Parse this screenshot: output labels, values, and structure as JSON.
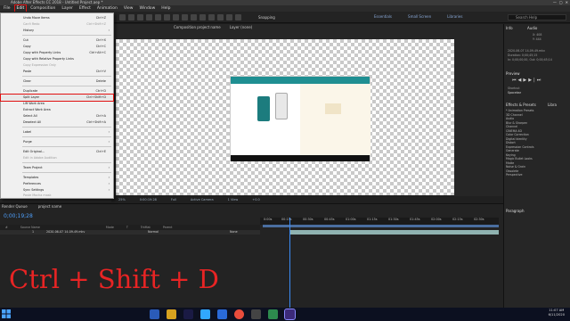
{
  "titlebar": {
    "title": "Adobe After Effects CC 2018 - Untitled Project.aep *"
  },
  "menubar": {
    "items": [
      "File",
      "Edit",
      "Composition",
      "Layer",
      "Effect",
      "Animation",
      "View",
      "Window",
      "Help"
    ],
    "active": "Edit"
  },
  "toolbar": {
    "snapping": "Snapping",
    "workspaces": [
      "Essentials",
      "Small Screen",
      "Libraries"
    ],
    "search_placeholder": "Search Help"
  },
  "comp_panel": {
    "tabs": [
      "Composition project name",
      "Layer (none)"
    ],
    "view_bar": [
      "25%",
      "0:00:19:28",
      "Full",
      "Active Camera",
      "1 View",
      "+0.0"
    ]
  },
  "edit_menu": {
    "items": [
      {
        "label": "Undo Move Items",
        "shortcut": "Ctrl+Z",
        "disabled": false
      },
      {
        "label": "Can't Redo",
        "shortcut": "Ctrl+Shift+Z",
        "disabled": true
      },
      {
        "label": "History",
        "shortcut": "",
        "disabled": false,
        "submenu": true
      },
      {
        "label": "Cut",
        "shortcut": "Ctrl+X",
        "disabled": false
      },
      {
        "label": "Copy",
        "shortcut": "Ctrl+C",
        "disabled": false
      },
      {
        "label": "Copy with Property Links",
        "shortcut": "Ctrl+Alt+C",
        "disabled": false
      },
      {
        "label": "Copy with Relative Property Links",
        "shortcut": "",
        "disabled": false
      },
      {
        "label": "Copy Expression Only",
        "shortcut": "",
        "disabled": true
      },
      {
        "label": "Paste",
        "shortcut": "Ctrl+V",
        "disabled": false
      },
      {
        "label": "Clear",
        "shortcut": "Delete",
        "disabled": false
      },
      {
        "label": "Duplicate",
        "shortcut": "Ctrl+D",
        "disabled": false
      },
      {
        "label": "Split Layer",
        "shortcut": "Ctrl+Shift+D",
        "disabled": false,
        "highlighted": true
      },
      {
        "label": "Lift Work Area",
        "shortcut": "",
        "disabled": false
      },
      {
        "label": "Extract Work Area",
        "shortcut": "",
        "disabled": false
      },
      {
        "label": "Select All",
        "shortcut": "Ctrl+A",
        "disabled": false
      },
      {
        "label": "Deselect All",
        "shortcut": "Ctrl+Shift+A",
        "disabled": false
      },
      {
        "label": "Label",
        "shortcut": "",
        "disabled": false,
        "submenu": true
      },
      {
        "label": "Purge",
        "shortcut": "",
        "disabled": false,
        "submenu": true
      },
      {
        "label": "Edit Original...",
        "shortcut": "Ctrl+E",
        "disabled": false
      },
      {
        "label": "Edit in Adobe Audition",
        "shortcut": "",
        "disabled": true
      },
      {
        "label": "Team Project",
        "shortcut": "",
        "disabled": false,
        "submenu": true
      },
      {
        "label": "Templates",
        "shortcut": "",
        "disabled": false,
        "submenu": true
      },
      {
        "label": "Preferences",
        "shortcut": "",
        "disabled": false,
        "submenu": true
      },
      {
        "label": "Sync Settings",
        "shortcut": "",
        "disabled": false,
        "submenu": true
      },
      {
        "label": "Paste Mocha mask",
        "shortcut": "",
        "disabled": true
      }
    ]
  },
  "right_panel": {
    "info_tab": "Info",
    "audio_tab": "Audio",
    "info_lines": [
      "X: 408",
      "Y: 444",
      "2020-06-07 14-09-49.mkv",
      "Duration: 0;00;45;15",
      "In: 0;00;00;00, Out: 0;00;45;14"
    ],
    "preview": "Preview",
    "shortcut_label": "Shortcut",
    "shortcut_value": "Spacebar",
    "effects_title": "Effects & Presets",
    "libraries_tab": "Libra",
    "effects": [
      "* Animation Presets",
      "3D Channel",
      "Audio",
      "Blur & Sharpen",
      "Channel",
      "CINEMA 4D",
      "Color Correction",
      "Digital Identity",
      "Distort",
      "Expression Controls",
      "Generate",
      "Keying",
      "Magic Bullet Looks",
      "Matte",
      "Noise & Grain",
      "Obsolete",
      "Perspective"
    ],
    "paragraph": "Paragraph"
  },
  "timeline": {
    "tabs": [
      "Render Queue",
      "project name"
    ],
    "timecode": "0;00;19;28",
    "headers": [
      "#",
      "Source Name",
      "Mode",
      "T",
      "TrkMat",
      "Parent"
    ],
    "layer": {
      "index": "1",
      "name": "2020-06-07 14-09-49.mkv",
      "mode": "Normal",
      "parent": "None"
    },
    "ruler": [
      "0:00s",
      "00:15s",
      "00:30s",
      "00:45s",
      "01:00s",
      "01:15s",
      "01:30s",
      "01:45s",
      "02:00s",
      "02:15s",
      "02:30s"
    ]
  },
  "overlay": {
    "shortcut_text": "Ctrl + Shift + D"
  },
  "taskbar": {
    "time": "11:07 AM",
    "date": "6/11/2020"
  },
  "colors": {
    "accent_red": "#e82424",
    "timecode_blue": "#4e9ffb",
    "highlight_outline": "#e01010"
  }
}
